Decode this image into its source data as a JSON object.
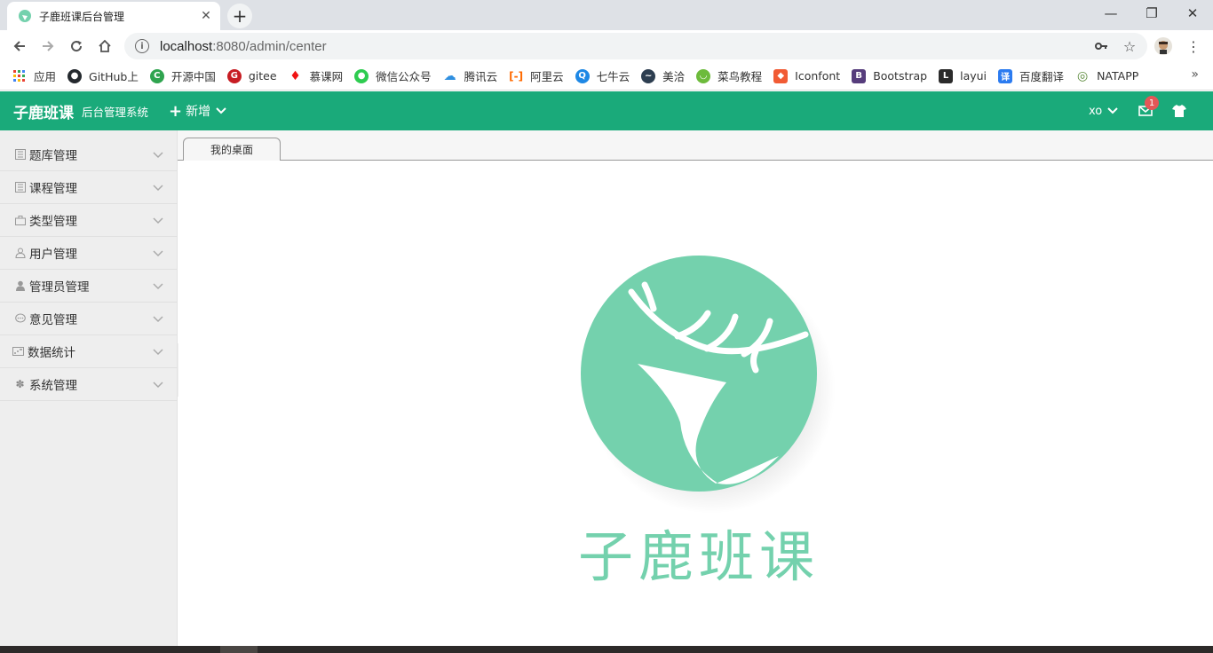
{
  "browser": {
    "tab_title": "子鹿班课后台管理",
    "url_host": "localhost",
    "url_rest": ":8080/admin/center",
    "bookmarks": [
      {
        "label": "应用",
        "icon": "apps-grid-icon",
        "color": "#e94235"
      },
      {
        "label": "GitHub上",
        "icon": "github-icon",
        "color": "#24292e"
      },
      {
        "label": "开源中国",
        "icon": "oschina-icon",
        "color": "#2fa44f"
      },
      {
        "label": "gitee",
        "icon": "gitee-icon",
        "color": "#c71d23"
      },
      {
        "label": "慕课网",
        "icon": "flame-icon",
        "color": "#f01414"
      },
      {
        "label": "微信公众号",
        "icon": "wechat-icon",
        "color": "#2ecc50"
      },
      {
        "label": "腾讯云",
        "icon": "cloud-icon",
        "color": "#2f8fe0"
      },
      {
        "label": "阿里云",
        "icon": "aliyun-icon",
        "color": "#ff6a00"
      },
      {
        "label": "七牛云",
        "icon": "qiniu-icon",
        "color": "#1e88e5"
      },
      {
        "label": "美洽",
        "icon": "meiqia-icon",
        "color": "#2d3e50"
      },
      {
        "label": "菜鸟教程",
        "icon": "runoob-icon",
        "color": "#6dbb3c"
      },
      {
        "label": "Iconfont",
        "icon": "iconfont-icon",
        "color": "#f15b34"
      },
      {
        "label": "Bootstrap",
        "icon": "bootstrap-icon",
        "color": "#563d7c"
      },
      {
        "label": "layui",
        "icon": "layui-icon",
        "color": "#2b2b2b"
      },
      {
        "label": "百度翻译",
        "icon": "baidu-translate-icon",
        "color": "#2b7bf0"
      },
      {
        "label": "NATAPP",
        "icon": "natapp-icon",
        "color": "#5a8a3a"
      }
    ]
  },
  "header": {
    "logo_main": "子鹿班课",
    "logo_sub": "后台管理系统",
    "add_label": "新增",
    "user_label": "xo",
    "unread_count": "1",
    "accent": "#1aaa7a"
  },
  "sidebar": {
    "items": [
      {
        "label": "题库管理",
        "icon": "list-icon"
      },
      {
        "label": "课程管理",
        "icon": "list-icon"
      },
      {
        "label": "类型管理",
        "icon": "bag-icon"
      },
      {
        "label": "用户管理",
        "icon": "user-outline-icon"
      },
      {
        "label": "管理员管理",
        "icon": "user-solid-icon"
      },
      {
        "label": "意见管理",
        "icon": "chat-bubble-icon"
      },
      {
        "label": "数据统计",
        "icon": "chart-icon"
      },
      {
        "label": "系统管理",
        "icon": "gear-icon"
      }
    ]
  },
  "main": {
    "tab_label": "我的桌面",
    "brand_text": "子鹿班课",
    "brand_color": "#74d1ad"
  }
}
